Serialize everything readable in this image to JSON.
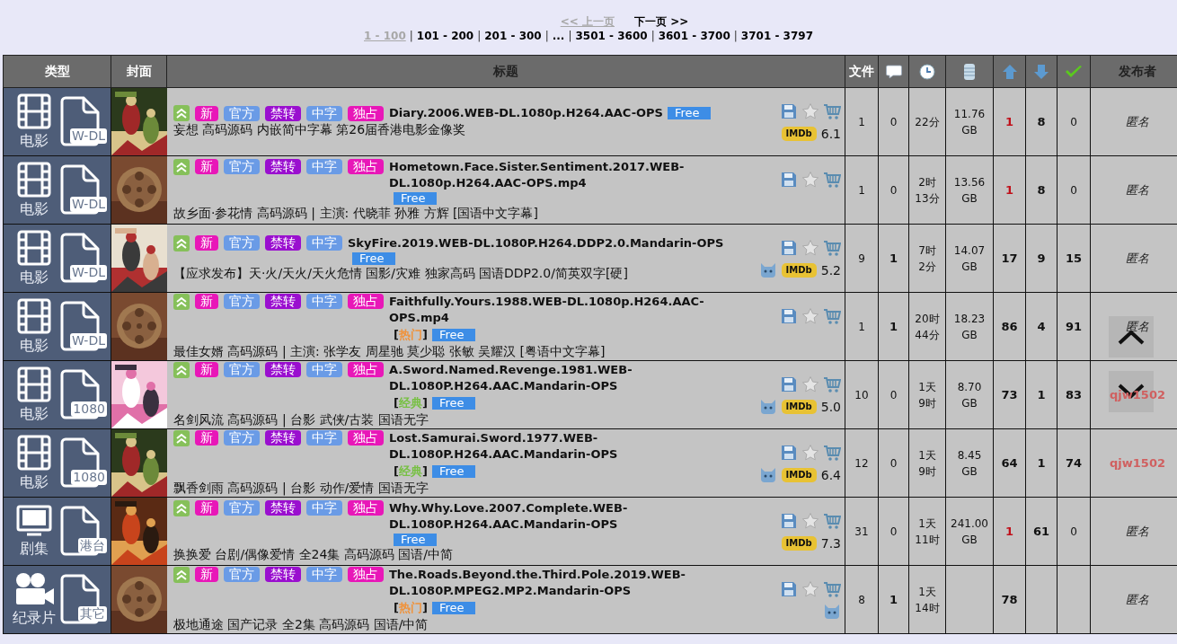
{
  "pager": {
    "prev": {
      "label": "<< 上一页",
      "disabled": true
    },
    "next": {
      "label": "下一页 >>",
      "disabled": false
    },
    "ranges": [
      {
        "label": "1 - 100",
        "selected": true
      },
      {
        "sep": "|",
        "label": "101 - 200",
        "selected": false
      },
      {
        "sep": "|",
        "label": "201 - 300",
        "selected": false
      },
      {
        "sep": "|",
        "label": "...",
        "selected": false
      },
      {
        "sep": "|",
        "label": "3501 - 3600",
        "selected": false
      },
      {
        "sep": "|",
        "label": "3601 - 3700",
        "selected": false
      },
      {
        "sep": "|",
        "label": "3701 - 3797",
        "selected": false
      }
    ]
  },
  "header": {
    "type": "类型",
    "cover": "封面",
    "title": "标题",
    "files": "文件",
    "uploader": "发布者"
  },
  "rows": [
    {
      "category": "电影",
      "kind": "movie",
      "format": "W-DL",
      "cover": {
        "kind": "poster"
      },
      "sticky": true,
      "tags": [
        {
          "label": "新",
          "kind": "new"
        },
        {
          "label": "官方",
          "kind": "official"
        },
        {
          "label": "禁转",
          "kind": "no_repost"
        },
        {
          "label": "中字",
          "kind": "chinese_sub"
        },
        {
          "label": "独占",
          "kind": "exclusive"
        }
      ],
      "title": "Diary.2006.WEB-DL.1080p.H264.AAC-OPS",
      "free": "Free",
      "description": "妄想 高码源码 内嵌简中字幕 第26届香港电影金像奖",
      "douban": false,
      "imdb": {
        "label": "IMDb",
        "rating": "6.1"
      },
      "files": "1",
      "comments": "0",
      "comments_bold": false,
      "time": [
        "22分"
      ],
      "size": [
        "11.76",
        "GB"
      ],
      "seeders": "1",
      "seeders_low": true,
      "leechers": "8",
      "completed": "0",
      "completed_bold": false,
      "uploader": {
        "name": "匿名",
        "kind": "anonymous"
      }
    },
    {
      "category": "电影",
      "kind": "movie",
      "format": "W-DL",
      "cover": {
        "kind": "no_poster"
      },
      "sticky": true,
      "tags": [
        {
          "label": "新",
          "kind": "new"
        },
        {
          "label": "官方",
          "kind": "official"
        },
        {
          "label": "禁转",
          "kind": "no_repost"
        },
        {
          "label": "中字",
          "kind": "chinese_sub"
        },
        {
          "label": "独占",
          "kind": "exclusive"
        }
      ],
      "title": "Hometown.Face.Sister.Sentiment.2017.WEB-DL.1080p.H264.AAC-OPS.mp4",
      "free": "Free",
      "description": "故乡面·参花情 高码源码 | 主演: 代晓菲 孙雅 方辉 [国语中文字幕]",
      "douban": false,
      "files": "1",
      "comments": "0",
      "comments_bold": false,
      "time": [
        "2时",
        "13分"
      ],
      "size": [
        "13.56",
        "GB"
      ],
      "seeders": "1",
      "seeders_low": true,
      "leechers": "8",
      "completed": "0",
      "completed_bold": false,
      "uploader": {
        "name": "匿名",
        "kind": "anonymous"
      }
    },
    {
      "category": "电影",
      "kind": "movie",
      "format": "W-DL",
      "cover": {
        "kind": "poster"
      },
      "sticky": true,
      "tags": [
        {
          "label": "新",
          "kind": "new"
        },
        {
          "label": "官方",
          "kind": "official"
        },
        {
          "label": "禁转",
          "kind": "no_repost"
        },
        {
          "label": "中字",
          "kind": "chinese_sub"
        }
      ],
      "title": "SkyFire.2019.WEB-DL.1080P.H264.DDP2.0.Mandarin-OPS",
      "free": "Free",
      "description": "【应求发布】天·火/天火/天火危情 国影/灾难 独家高码 国语DDP2.0/简英双字[硬]",
      "douban": true,
      "imdb": {
        "label": "IMDb",
        "rating": "5.2"
      },
      "files": "9",
      "comments": "1",
      "comments_bold": true,
      "time": [
        "7时",
        "2分"
      ],
      "size": [
        "14.07",
        "GB"
      ],
      "seeders": "17",
      "seeders_low": false,
      "leechers": "9",
      "completed": "15",
      "completed_bold": true,
      "uploader": {
        "name": "匿名",
        "kind": "anonymous"
      }
    },
    {
      "category": "电影",
      "kind": "movie",
      "format": "W-DL",
      "cover": {
        "kind": "no_poster"
      },
      "sticky": true,
      "tags": [
        {
          "label": "新",
          "kind": "new"
        },
        {
          "label": "官方",
          "kind": "official"
        },
        {
          "label": "禁转",
          "kind": "no_repost"
        },
        {
          "label": "中字",
          "kind": "chinese_sub"
        },
        {
          "label": "独占",
          "kind": "exclusive"
        }
      ],
      "title": "Faithfully.Yours.1988.WEB-DL.1080p.H264.AAC-OPS.mp4",
      "label": {
        "open": "[",
        "text": "热门",
        "close": "]",
        "kind": "hot"
      },
      "free": "Free",
      "description": "最佳女婿 高码源码 | 主演: 张学友 周星驰 莫少聪 张敏 吴耀汉 [粤语中文字幕]",
      "douban": false,
      "files": "1",
      "comments": "1",
      "comments_bold": true,
      "time": [
        "20时",
        "44分"
      ],
      "size": [
        "18.23",
        "GB"
      ],
      "seeders": "86",
      "seeders_low": false,
      "leechers": "4",
      "completed": "91",
      "completed_bold": true,
      "uploader": {
        "name": "匿名",
        "kind": "anonymous"
      }
    },
    {
      "category": "电影",
      "kind": "movie",
      "format": "1080",
      "cover": {
        "kind": "poster"
      },
      "sticky": true,
      "tags": [
        {
          "label": "新",
          "kind": "new"
        },
        {
          "label": "官方",
          "kind": "official"
        },
        {
          "label": "禁转",
          "kind": "no_repost"
        },
        {
          "label": "中字",
          "kind": "chinese_sub"
        },
        {
          "label": "独占",
          "kind": "exclusive"
        }
      ],
      "title": "A.Sword.Named.Revenge.1981.WEB-DL.1080P.H264.AAC.Mandarin-OPS",
      "label": {
        "open": "[",
        "text": "经典",
        "close": "]",
        "kind": "classic"
      },
      "free": "Free",
      "description": "名剑风流 高码源码 | 台影 武侠/古装 国语无字",
      "douban": true,
      "imdb": {
        "label": "IMDb",
        "rating": "5.0"
      },
      "files": "10",
      "comments": "0",
      "comments_bold": false,
      "time": [
        "1天",
        "9时"
      ],
      "size": [
        "8.70",
        "GB"
      ],
      "seeders": "73",
      "seeders_low": false,
      "leechers": "1",
      "completed": "83",
      "completed_bold": true,
      "uploader": {
        "name": "qjw1502",
        "kind": "user"
      }
    },
    {
      "category": "电影",
      "kind": "movie",
      "format": "1080",
      "cover": {
        "kind": "poster"
      },
      "sticky": true,
      "tags": [
        {
          "label": "新",
          "kind": "new"
        },
        {
          "label": "官方",
          "kind": "official"
        },
        {
          "label": "禁转",
          "kind": "no_repost"
        },
        {
          "label": "中字",
          "kind": "chinese_sub"
        },
        {
          "label": "独占",
          "kind": "exclusive"
        }
      ],
      "title": "Lost.Samurai.Sword.1977.WEB-DL.1080P.H264.AAC.Mandarin-OPS",
      "label": {
        "open": "[",
        "text": "经典",
        "close": "]",
        "kind": "classic"
      },
      "free": "Free",
      "description": "飘香剑雨 高码源码 | 台影 动作/爱情 国语无字",
      "douban": true,
      "imdb": {
        "label": "IMDb",
        "rating": "6.4"
      },
      "files": "12",
      "comments": "0",
      "comments_bold": false,
      "time": [
        "1天",
        "9时"
      ],
      "size": [
        "8.45",
        "GB"
      ],
      "seeders": "64",
      "seeders_low": false,
      "leechers": "1",
      "completed": "74",
      "completed_bold": true,
      "uploader": {
        "name": "qjw1502",
        "kind": "user"
      }
    },
    {
      "category": "剧集",
      "kind": "series",
      "format": "港台",
      "cover": {
        "kind": "poster"
      },
      "sticky": true,
      "tags": [
        {
          "label": "新",
          "kind": "new"
        },
        {
          "label": "官方",
          "kind": "official"
        },
        {
          "label": "禁转",
          "kind": "no_repost"
        },
        {
          "label": "中字",
          "kind": "chinese_sub"
        },
        {
          "label": "独占",
          "kind": "exclusive"
        }
      ],
      "title": "Why.Why.Love.2007.Complete.WEB-DL.1080P.H264.AAC.Mandarin-OPS",
      "free": "Free",
      "description": "换换爱 台剧/偶像爱情 全24集 高码源码 国语/中简",
      "douban": false,
      "imdb": {
        "label": "IMDb",
        "rating": "7.3"
      },
      "files": "31",
      "comments": "0",
      "comments_bold": false,
      "time": [
        "1天",
        "11时"
      ],
      "size": [
        "241.00",
        "GB"
      ],
      "seeders": "1",
      "seeders_low": true,
      "leechers": "61",
      "completed": "0",
      "completed_bold": false,
      "uploader": {
        "name": "匿名",
        "kind": "anonymous"
      }
    },
    {
      "category": "纪录片",
      "kind": "documentary",
      "format": "其它",
      "cover": {
        "kind": "no_poster"
      },
      "sticky": true,
      "tags": [
        {
          "label": "新",
          "kind": "new"
        },
        {
          "label": "官方",
          "kind": "official"
        },
        {
          "label": "禁转",
          "kind": "no_repost"
        },
        {
          "label": "中字",
          "kind": "chinese_sub"
        },
        {
          "label": "独占",
          "kind": "exclusive"
        }
      ],
      "title": "The.Roads.Beyond.the.Third.Pole.2019.WEB-DL.1080P.MPEG2.MP2.Mandarin-OPS",
      "label": {
        "open": "[",
        "text": "热门",
        "close": "]",
        "kind": "hot"
      },
      "free": "Free",
      "description": "极地通途 国产记录 全2集 高码源码 国语/中简",
      "douban": true,
      "files": "8",
      "comments": "1",
      "comments_bold": true,
      "time": [
        "1天",
        "14时"
      ],
      "seeders": "78",
      "seeders_low": false,
      "uploader": {
        "name": "匿名",
        "kind": "anonymous"
      }
    }
  ]
}
